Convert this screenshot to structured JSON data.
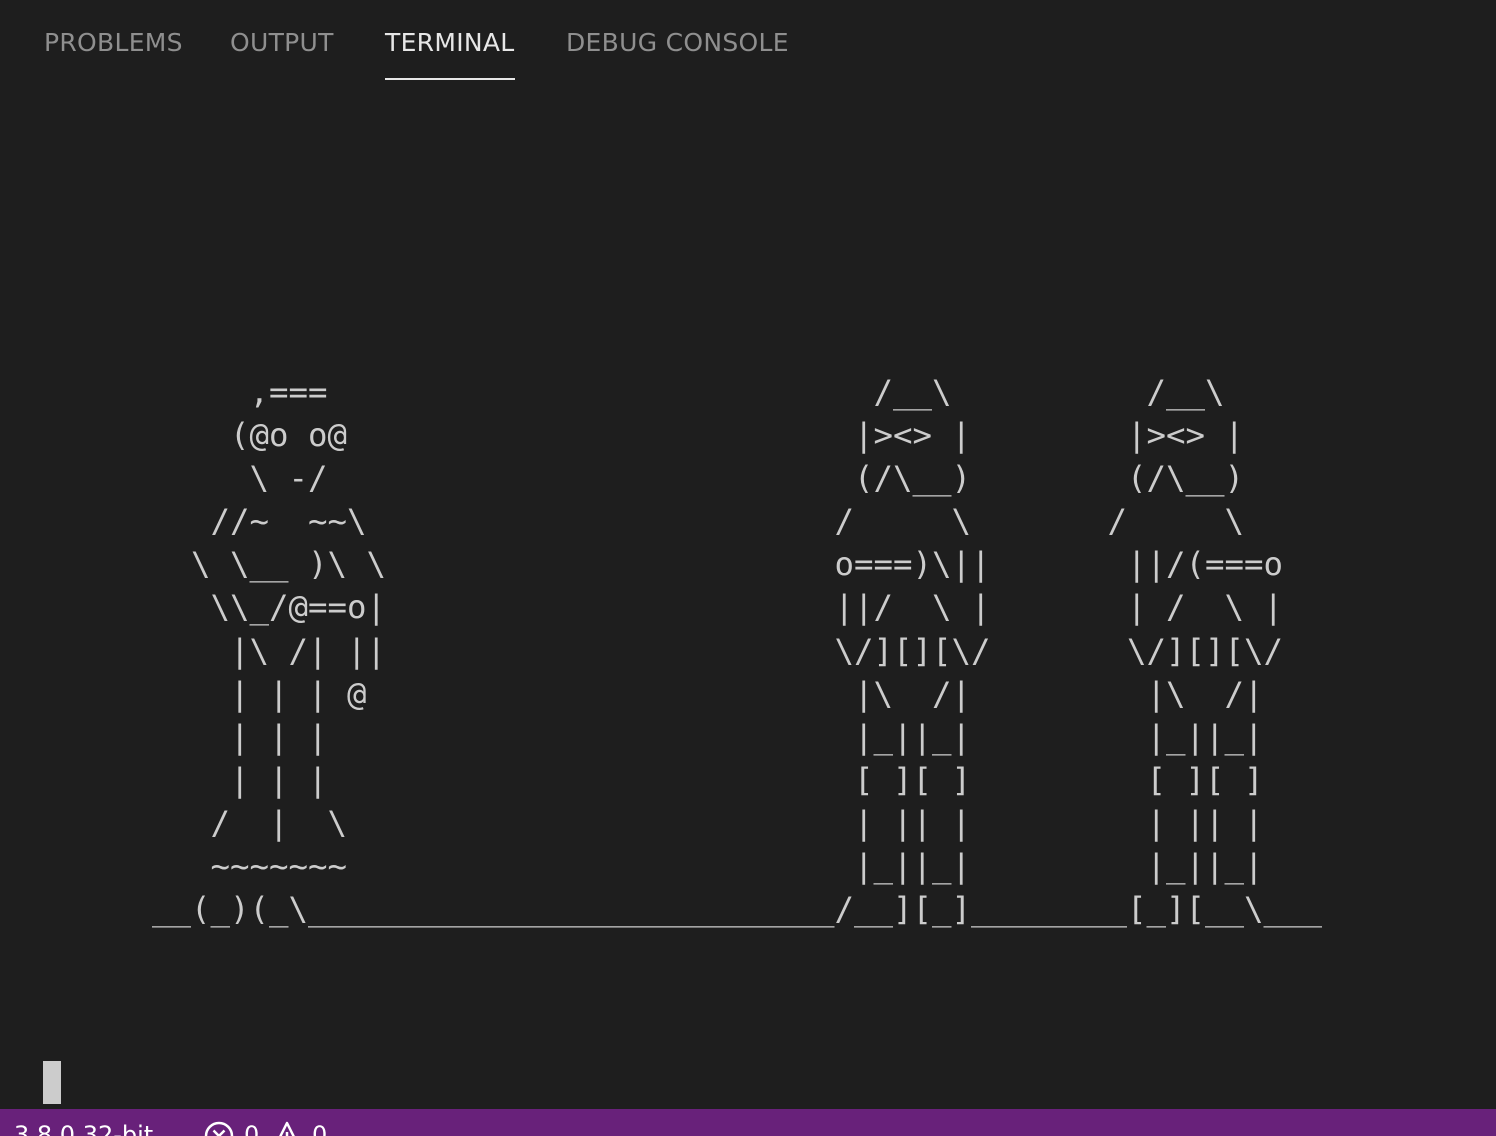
{
  "tabs": [
    {
      "label": "PROBLEMS",
      "active": false
    },
    {
      "label": "OUTPUT",
      "active": false
    },
    {
      "label": "TERMINAL",
      "active": true
    },
    {
      "label": "DEBUG CONSOLE",
      "active": false
    }
  ],
  "terminal": {
    "ascii_art": "     ,===                            /__\\          /__\\\n    (@o o@                          |><> |        |><> |\n     \\ -/                           (/\\__)        (/\\__)\n   //~  ~~\\                        /     \\       /     \\\n  \\ \\__ )\\ \\                       o===)\\||       ||/(===o\n   \\\\_/@==o|                       ||/  \\ |       | /  \\ |\n    |\\ /| ||                       \\/][][\\/       \\/][][\\/\n    | | | @                         |\\  /|         |\\  /|\n    | | |                           |_||_|         |_||_|\n    | | |                           [ ][ ]         [ ][ ]\n   /  |  \\                          | || |         | || |\n   ~~~~~~~                          |_||_|         |_||_|\n__(_)(_\\___________________________/__][_]________[_][__\\___"
  },
  "statusbar": {
    "python_version": "3.8.0 32-bit",
    "errors": "0",
    "warnings": "0",
    "background_color": "#68217a"
  },
  "colors": {
    "background": "#1e1e1e",
    "text": "#cccccc",
    "tab_inactive": "#8f8f8f",
    "tab_active": "#e7e7e7"
  }
}
